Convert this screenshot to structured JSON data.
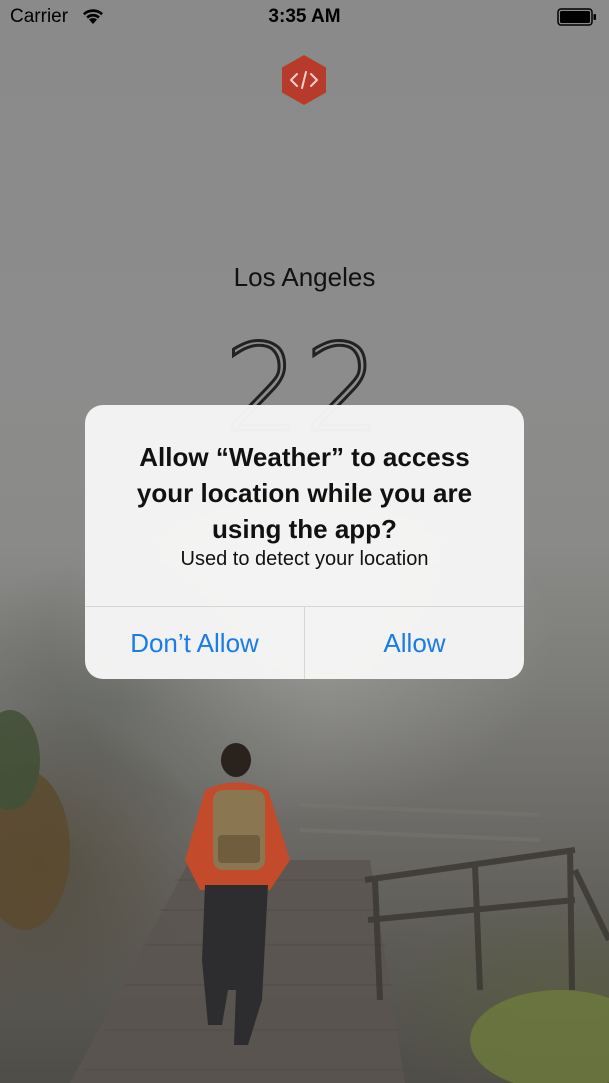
{
  "status_bar": {
    "carrier": "Carrier",
    "time": "3:35 AM",
    "wifi_icon": "wifi-icon",
    "battery_icon": "battery-full-icon"
  },
  "app": {
    "logo_icon": "code-brackets-hexagon-icon",
    "logo_color": "#b83a2a",
    "city": "Los Angeles",
    "temperature": "22"
  },
  "alert": {
    "title": "Allow “Weather” to access your location while you are using the app?",
    "message": "Used to detect your location",
    "buttons": [
      {
        "label": "Don’t Allow"
      },
      {
        "label": "Allow"
      }
    ],
    "button_color": "#1a7ce6"
  }
}
